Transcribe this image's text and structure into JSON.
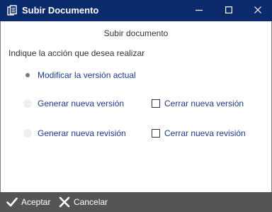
{
  "window": {
    "title": "Subir Documento",
    "app_icon": "documents-icon",
    "controls": [
      "minimize-icon",
      "maximize-icon",
      "close-icon"
    ]
  },
  "dialog": {
    "heading": "Subir documento",
    "prompt": "Indique la acción que desea realizar",
    "options": {
      "modificar": {
        "label": "Modificar la versión actual",
        "selected": true,
        "enabled": true
      },
      "generar_version": {
        "label": "Generar nueva versión",
        "selected": false,
        "enabled": false
      },
      "generar_revision": {
        "label": "Generar nueva revisión",
        "selected": false,
        "enabled": false
      },
      "cerrar_version": {
        "label": "Cerrar nueva versión",
        "checked": false
      },
      "cerrar_revision": {
        "label": "Cerrar nueva revisión",
        "checked": false
      }
    }
  },
  "footer": {
    "accept_label": "Aceptar",
    "accept_icon": "check-icon",
    "cancel_label": "Cancelar",
    "cancel_icon": "x-icon"
  },
  "colors": {
    "titlebar": "#0b2a6b",
    "option_text": "#1d3b88",
    "footer": "#555555"
  }
}
